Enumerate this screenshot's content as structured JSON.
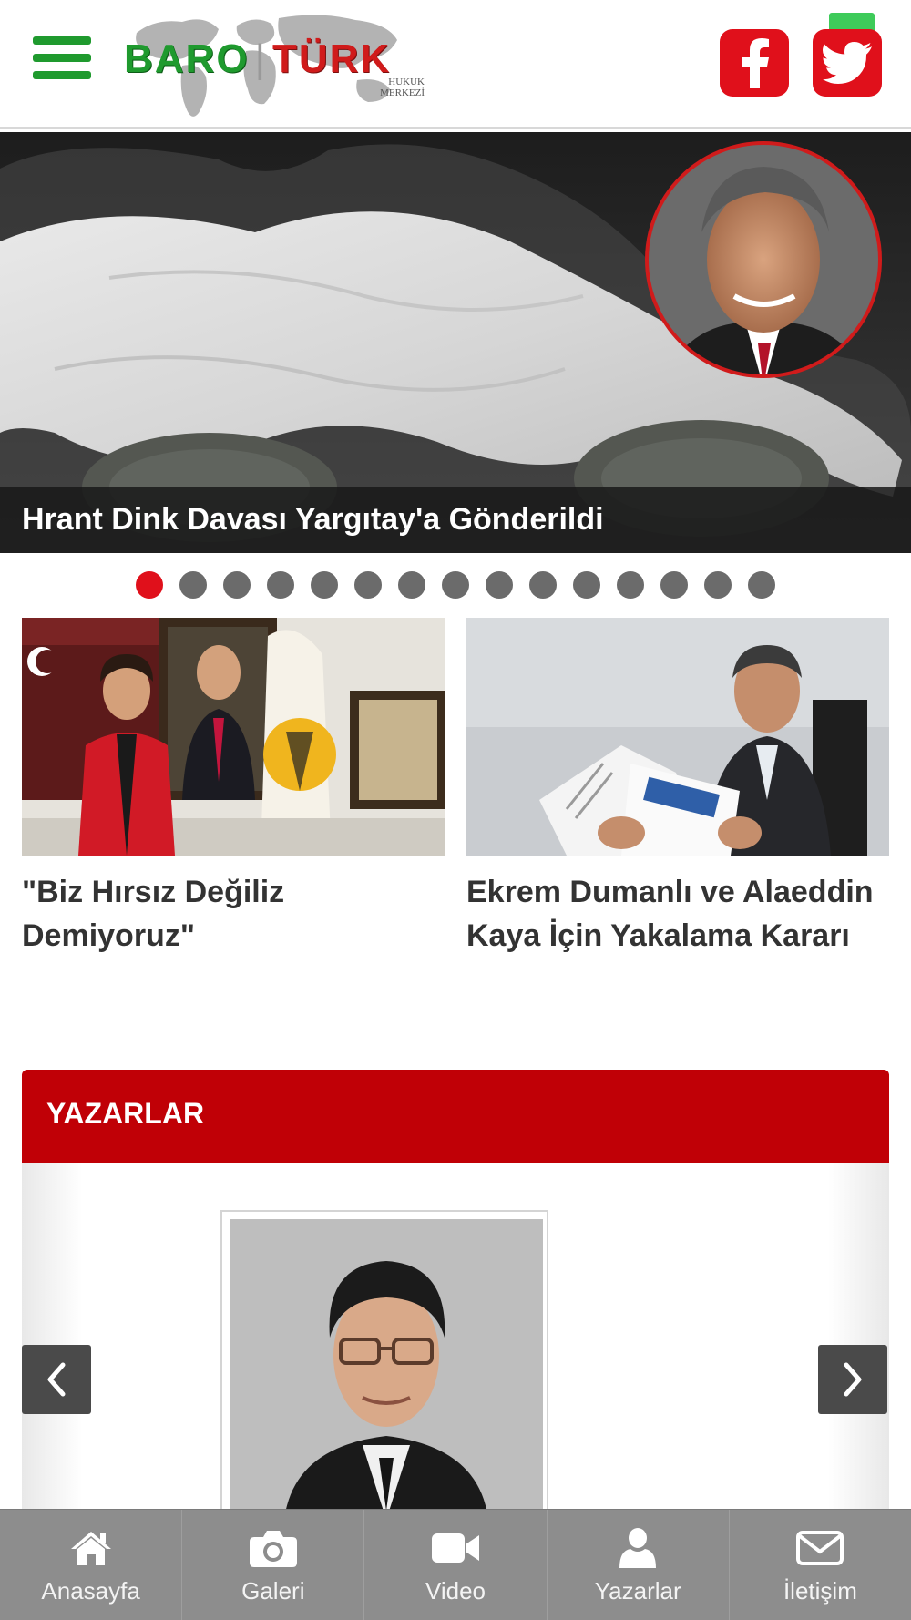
{
  "header": {
    "logo_left": "BARO",
    "logo_right": "TÜRK",
    "logo_sub_1": "HUKUK",
    "logo_sub_2": "MERKEZİ",
    "menu_icon": "hamburger-menu-icon",
    "social": [
      {
        "name": "facebook",
        "icon": "facebook-icon",
        "color": "#e0101b"
      },
      {
        "name": "twitter",
        "icon": "twitter-icon",
        "color": "#e0101b"
      }
    ]
  },
  "slider": {
    "headline": "Hrant Dink Davası Yargıtay'a Gönderildi",
    "dot_count": 15,
    "active_dot": 1
  },
  "news": [
    {
      "title": "\"Biz Hırsız Değiliz Demiyoruz\""
    },
    {
      "title": "Ekrem Dumanlı ve Alaeddin Kaya İçin Yakalama Kararı"
    }
  ],
  "authors": {
    "section_title": "YAZARLAR",
    "prev_icon": "chevron-left-icon",
    "next_icon": "chevron-right-icon"
  },
  "bottom_nav": [
    {
      "label": "Anasayfa",
      "icon": "home-icon"
    },
    {
      "label": "Galeri",
      "icon": "camera-icon"
    },
    {
      "label": "Video",
      "icon": "video-camera-icon"
    },
    {
      "label": "Yazarlar",
      "icon": "user-icon"
    },
    {
      "label": "İletişim",
      "icon": "envelope-icon"
    }
  ],
  "colors": {
    "brand_green": "#1f9a2e",
    "brand_red": "#c00006",
    "social_red": "#e0101b",
    "nav_gray": "#8d8d8d"
  }
}
